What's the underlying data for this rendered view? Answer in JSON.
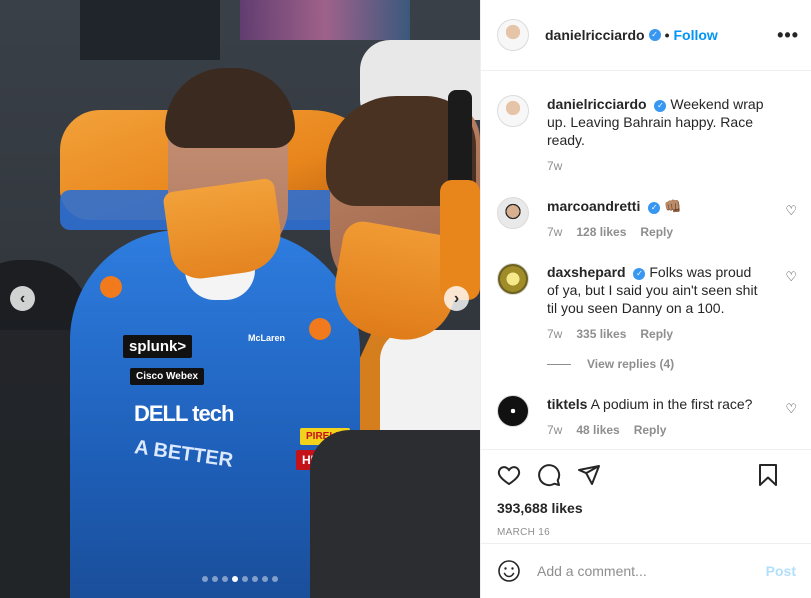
{
  "post": {
    "author": "danielricciardo",
    "follow_label": "Follow",
    "separator": "•",
    "more_label": "•••",
    "caption": "Weekend wrap up. Leaving Bahrain happy. Race ready.",
    "caption_time": "7w",
    "likes": "393,688 likes",
    "date": "MARCH 16",
    "carousel": {
      "prev": "‹",
      "next": "›",
      "slide_count": 8,
      "active_slide": 3
    }
  },
  "photo_text": {
    "splunk": "splunk>",
    "webex": "Cisco Webex",
    "dell": "DELL tech",
    "better": "A BETTER",
    "pirelli": "PIRELLI",
    "husky": "HUSKY",
    "mclaren": "McLaren"
  },
  "comments": [
    {
      "user": "marcoandretti",
      "verified": true,
      "text": "👊🏽",
      "time": "7w",
      "likes": "128 likes",
      "reply": "Reply"
    },
    {
      "user": "daxshepard",
      "verified": true,
      "text": "Folks was proud of ya, but I said you ain't seen shit til you seen Danny on a 100.",
      "time": "7w",
      "likes": "335 likes",
      "reply": "Reply",
      "view_replies": "View replies (4)"
    },
    {
      "user": "tiktels",
      "verified": false,
      "text": "A podium in the first race?",
      "time": "7w",
      "likes": "48 likes",
      "reply": "Reply"
    }
  ],
  "add_comment": {
    "placeholder": "Add a comment...",
    "post_label": "Post"
  },
  "icons": {
    "heart": "heart-icon",
    "comment": "comment-icon",
    "share": "share-icon",
    "bookmark": "bookmark-icon",
    "emoji": "emoji-icon"
  },
  "colors": {
    "accent": "#0095f6",
    "verified": "#3897f0",
    "muted": "#8e8e8e",
    "post_disabled": "#b2dffc"
  }
}
